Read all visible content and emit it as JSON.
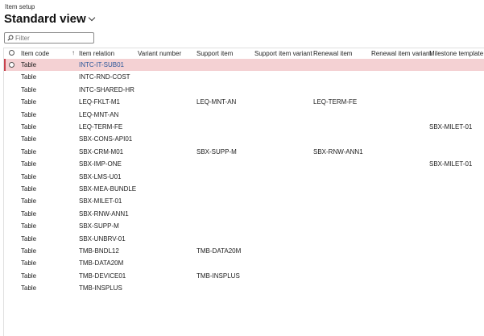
{
  "page": {
    "caption": "Item setup",
    "view_title": "Standard view"
  },
  "filter": {
    "placeholder": "Filter"
  },
  "columns": {
    "item_code": "Item code",
    "item_relation": "Item relation",
    "variant_number": "Variant number",
    "support_item": "Support item",
    "support_item_variant": "Support item variant",
    "renewal_item": "Renewal item",
    "renewal_item_variant": "Renewal item variant",
    "milestone_template": "Milestone template"
  },
  "rows": [
    {
      "item_code": "Table",
      "item_relation": "INTC-IT-SUB01",
      "support_item": "",
      "renewal_item": "",
      "milestone_template": ""
    },
    {
      "item_code": "Table",
      "item_relation": "INTC-RND-COST",
      "support_item": "",
      "renewal_item": "",
      "milestone_template": ""
    },
    {
      "item_code": "Table",
      "item_relation": "INTC-SHARED-HR",
      "support_item": "",
      "renewal_item": "",
      "milestone_template": ""
    },
    {
      "item_code": "Table",
      "item_relation": "LEQ-FKLT-M1",
      "support_item": "LEQ-MNT-AN",
      "renewal_item": "LEQ-TERM-FE",
      "milestone_template": ""
    },
    {
      "item_code": "Table",
      "item_relation": "LEQ-MNT-AN",
      "support_item": "",
      "renewal_item": "",
      "milestone_template": ""
    },
    {
      "item_code": "Table",
      "item_relation": "LEQ-TERM-FE",
      "support_item": "",
      "renewal_item": "",
      "milestone_template": "SBX-MILET-01"
    },
    {
      "item_code": "Table",
      "item_relation": "SBX-CONS-API01",
      "support_item": "",
      "renewal_item": "",
      "milestone_template": ""
    },
    {
      "item_code": "Table",
      "item_relation": "SBX-CRM-M01",
      "support_item": "SBX-SUPP-M",
      "renewal_item": "SBX-RNW-ANN1",
      "milestone_template": ""
    },
    {
      "item_code": "Table",
      "item_relation": "SBX-IMP-ONE",
      "support_item": "",
      "renewal_item": "",
      "milestone_template": "SBX-MILET-01"
    },
    {
      "item_code": "Table",
      "item_relation": "SBX-LMS-U01",
      "support_item": "",
      "renewal_item": "",
      "milestone_template": ""
    },
    {
      "item_code": "Table",
      "item_relation": "SBX-MEA-BUNDLE",
      "support_item": "",
      "renewal_item": "",
      "milestone_template": ""
    },
    {
      "item_code": "Table",
      "item_relation": "SBX-MILET-01",
      "support_item": "",
      "renewal_item": "",
      "milestone_template": ""
    },
    {
      "item_code": "Table",
      "item_relation": "SBX-RNW-ANN1",
      "support_item": "",
      "renewal_item": "",
      "milestone_template": ""
    },
    {
      "item_code": "Table",
      "item_relation": "SBX-SUPP-M",
      "support_item": "",
      "renewal_item": "",
      "milestone_template": ""
    },
    {
      "item_code": "Table",
      "item_relation": "SBX-UNBRV-01",
      "support_item": "",
      "renewal_item": "",
      "milestone_template": ""
    },
    {
      "item_code": "Table",
      "item_relation": "TMB-BNDL12",
      "support_item": "TMB-DATA20M",
      "renewal_item": "",
      "milestone_template": ""
    },
    {
      "item_code": "Table",
      "item_relation": "TMB-DATA20M",
      "support_item": "",
      "renewal_item": "",
      "milestone_template": ""
    },
    {
      "item_code": "Table",
      "item_relation": "TMB-DEVICE01",
      "support_item": "TMB-INSPLUS",
      "renewal_item": "",
      "milestone_template": ""
    },
    {
      "item_code": "Table",
      "item_relation": "TMB-INSPLUS",
      "support_item": "",
      "renewal_item": "",
      "milestone_template": ""
    }
  ],
  "colors": {
    "selected_row_bg": "#f4d1d3",
    "selected_row_accent": "#c8414c",
    "link": "#2b579a"
  },
  "icons": {
    "filter": "search-icon",
    "view_menu": "chevron-down-icon",
    "sort": "sort-up-arrow-icon"
  }
}
